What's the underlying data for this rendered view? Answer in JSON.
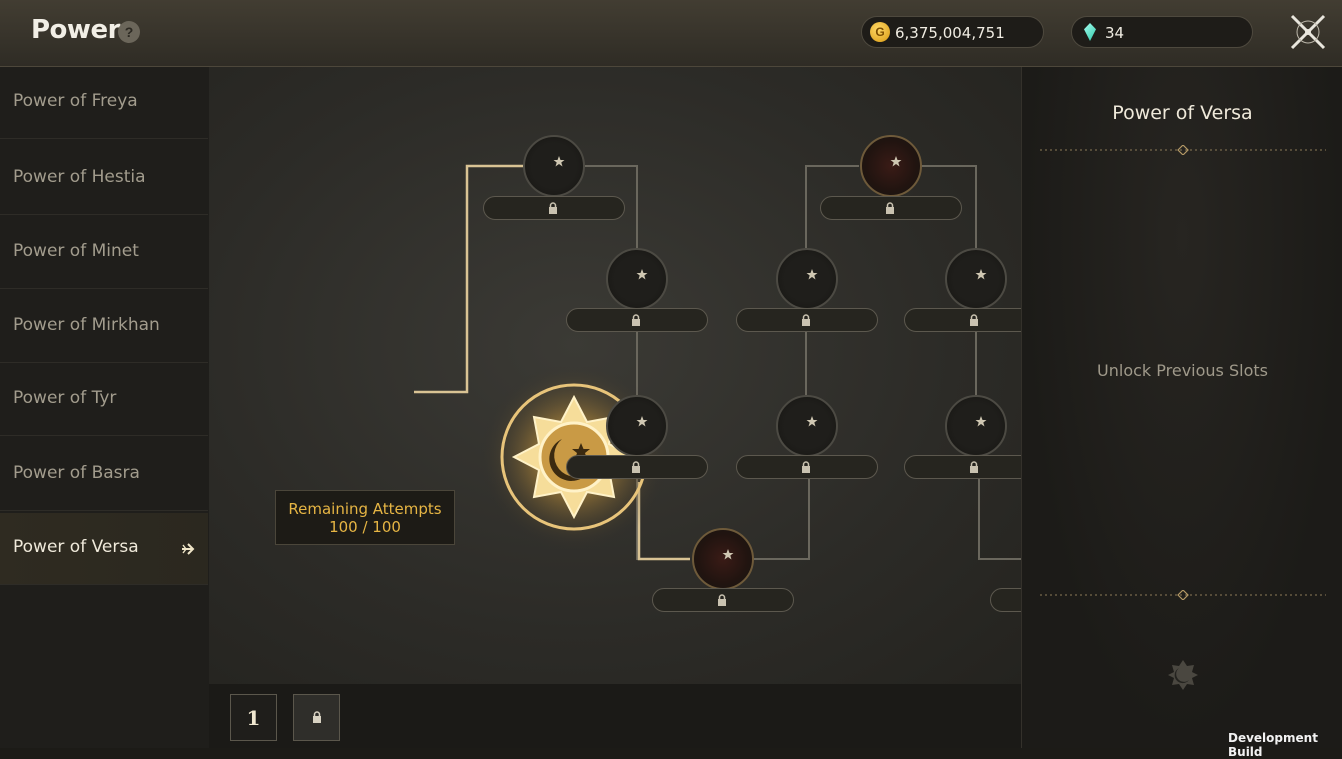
{
  "header": {
    "title": "Power",
    "help_label": "?",
    "gold": {
      "icon": "gold-coin-icon",
      "coin_letter": "G",
      "value": "6,375,004,751"
    },
    "gems": {
      "icon": "gem-icon",
      "value": "34"
    },
    "close_icon": "close-icon"
  },
  "sidebar": {
    "items": [
      {
        "label": "Power of Freya",
        "active": false
      },
      {
        "label": "Power of Hestia",
        "active": false
      },
      {
        "label": "Power of Minet",
        "active": false
      },
      {
        "label": "Power of Mirkhan",
        "active": false
      },
      {
        "label": "Power of Tyr",
        "active": false
      },
      {
        "label": "Power of Basra",
        "active": false
      },
      {
        "label": "Power of Versa",
        "active": true
      }
    ],
    "active_icon": "arrow-right-icon"
  },
  "main": {
    "emblem_icon": "crescent-star-icon",
    "attempts": {
      "label": "Remaining Attempts",
      "value": "100 / 100"
    },
    "slot_icon": "lock-icon",
    "node_icon": "crescent-star-icon"
  },
  "bottom": {
    "pages": [
      {
        "label": "1",
        "locked": false
      },
      {
        "label": "",
        "locked": true
      }
    ]
  },
  "detail": {
    "title": "Power of Versa",
    "message": "Unlock Previous Slots",
    "emblem_icon": "crescent-star-icon"
  },
  "footer": {
    "watermark": "Development Build"
  },
  "colors": {
    "accent_gold": "#e6b544",
    "active_line": "#d9c394",
    "inactive_line": "#6a675d"
  }
}
